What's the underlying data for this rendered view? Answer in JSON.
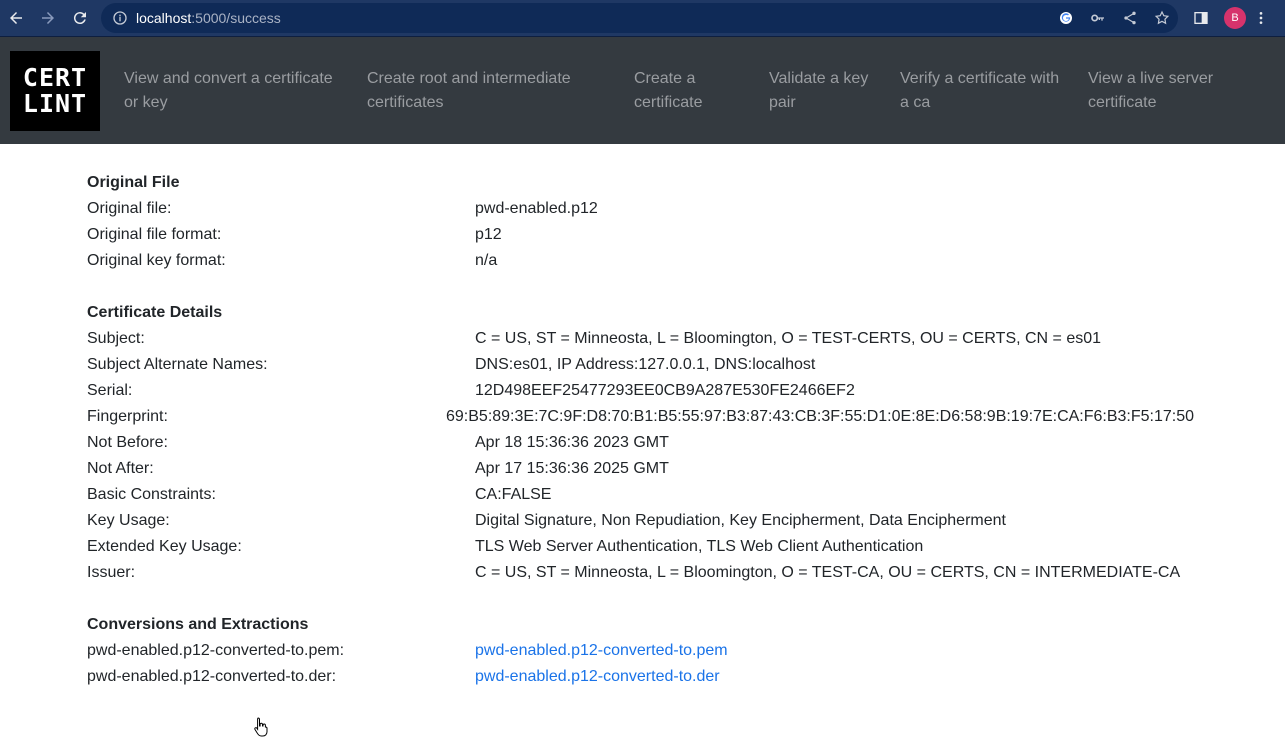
{
  "browser": {
    "url_host": "localhost",
    "url_path": ":5000/success",
    "profile_initial": "B"
  },
  "nav": {
    "logo_line1": "CERT",
    "logo_line2": "LINT",
    "links": [
      {
        "l1": "View and convert a certificate",
        "l2": "or key"
      },
      {
        "l1": "Create root and intermediate",
        "l2": "certificates"
      },
      {
        "l1": "Create a",
        "l2": "certificate"
      },
      {
        "l1": "Validate a key",
        "l2": "pair"
      },
      {
        "l1": "Verify a certificate with",
        "l2": "a ca"
      },
      {
        "l1": "View a live server",
        "l2": "certificate"
      }
    ]
  },
  "original": {
    "title": "Original File",
    "rows": [
      {
        "label": "Original file:",
        "value": "pwd-enabled.p12"
      },
      {
        "label": "Original file format:",
        "value": "p12"
      },
      {
        "label": "Original key format:",
        "value": "n/a"
      }
    ]
  },
  "details": {
    "title": "Certificate Details",
    "rows": [
      {
        "label": "Subject:",
        "value": "C = US, ST = Minneosta, L = Bloomington, O = TEST-CERTS, OU = CERTS, CN = es01"
      },
      {
        "label": "Subject Alternate Names:",
        "value": "DNS:es01, IP Address:127.0.0.1, DNS:localhost"
      },
      {
        "label": "Serial:",
        "value": "12D498EEF25477293EE0CB9A287E530FE2466EF2"
      },
      {
        "label": "Fingerprint:",
        "value": "69:B5:89:3E:7C:9F:D8:70:B1:B5:55:97:B3:87:43:CB:3F:55:D1:0E:8E:D6:58:9B:19:7E:CA:F6:B3:F5:17:50"
      },
      {
        "label": "Not Before:",
        "value": "Apr 18 15:36:36 2023 GMT"
      },
      {
        "label": "Not After:",
        "value": "Apr 17 15:36:36 2025 GMT"
      },
      {
        "label": "Basic Constraints:",
        "value": "CA:FALSE"
      },
      {
        "label": "Key Usage:",
        "value": "Digital Signature, Non Repudiation, Key Encipherment, Data Encipherment"
      },
      {
        "label": "Extended Key Usage:",
        "value": "TLS Web Server Authentication, TLS Web Client Authentication"
      },
      {
        "label": "Issuer:",
        "value": "C = US, ST = Minneosta, L = Bloomington, O = TEST-CA, OU = CERTS, CN = INTERMEDIATE-CA"
      }
    ]
  },
  "conversions": {
    "title": "Conversions and Extractions",
    "rows": [
      {
        "label": "pwd-enabled.p12-converted-to.pem:",
        "value": "pwd-enabled.p12-converted-to.pem"
      },
      {
        "label": "pwd-enabled.p12-converted-to.der:",
        "value": "pwd-enabled.p12-converted-to.der"
      }
    ]
  },
  "colors": {
    "browser_bar": "#1f3864",
    "navbar": "#343a40",
    "nav_link": "#9a9da1",
    "link": "#1a73e8",
    "avatar": "#d6336c"
  }
}
